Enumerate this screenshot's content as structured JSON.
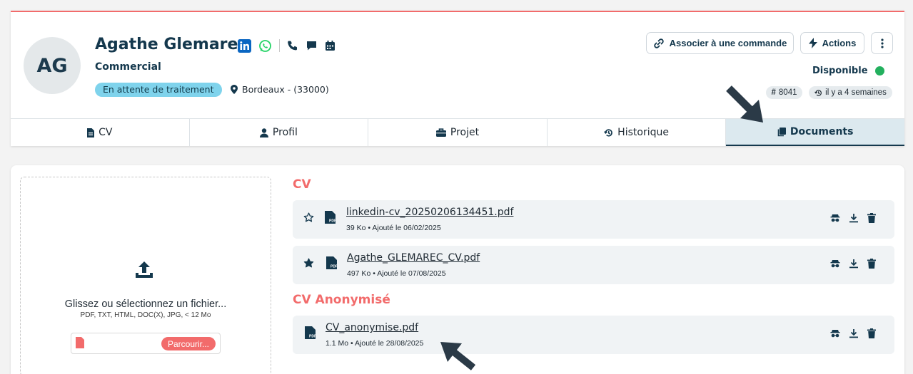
{
  "candidate": {
    "initials": "AG",
    "name": "Agathe Glemarec",
    "role": "Commercial",
    "status": "En attente de traitement",
    "location": "Bordeaux - (33000)",
    "availability": "Disponible",
    "id_badge": "8041",
    "updated": "il y a 4 semaines"
  },
  "header_buttons": {
    "associate": "Associer à une commande",
    "actions": "Actions"
  },
  "tabs": [
    {
      "label": "CV",
      "icon": "file-icon"
    },
    {
      "label": "Profil",
      "icon": "user-icon"
    },
    {
      "label": "Projet",
      "icon": "briefcase-icon"
    },
    {
      "label": "Historique",
      "icon": "history-icon"
    },
    {
      "label": "Documents",
      "icon": "documents-icon",
      "active": true
    }
  ],
  "dropzone": {
    "title": "Glissez ou sélectionnez un fichier...",
    "hint": "PDF, TXT, HTML, DOC(X), JPG, < 12 Mo",
    "browse": "Parcourir..."
  },
  "sections": {
    "cv": {
      "title": "CV",
      "files": [
        {
          "name": "linkedin-cv_20250206134451.pdf",
          "meta": "39 Ko • Ajouté le 06/02/2025",
          "starred": false
        },
        {
          "name": "Agathe_GLEMAREC_CV.pdf",
          "meta": "497 Ko • Ajouté le 07/08/2025",
          "starred": true
        }
      ]
    },
    "anonymized": {
      "title": "CV Anonymisé",
      "files": [
        {
          "name": "CV_anonymise.pdf",
          "meta": "1.1 Mo • Ajouté le 28/08/2025"
        }
      ]
    }
  },
  "colors": {
    "accent": "#f26b6b",
    "primary": "#14384d",
    "status_pill": "#7fd3ec",
    "available": "#23b05e",
    "active_tab": "#dce9ef"
  }
}
